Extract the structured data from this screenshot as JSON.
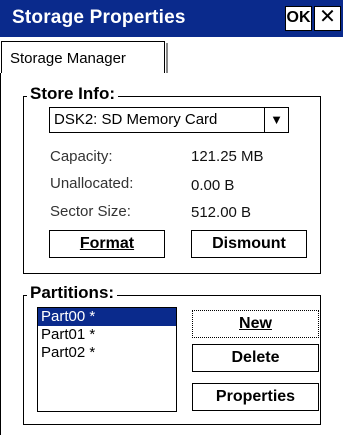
{
  "window": {
    "title": "Storage Properties",
    "ok_label": "OK",
    "close_glyph": "✕"
  },
  "tabs": [
    {
      "label": "Storage Manager"
    }
  ],
  "store_info": {
    "legend": "Store Info:",
    "selected_store": "DSK2: SD Memory Card",
    "fields": [
      {
        "label": "Capacity:",
        "value": "121.25 MB"
      },
      {
        "label": "Unallocated:",
        "value": "0.00 B"
      },
      {
        "label": "Sector Size:",
        "value": "512.00 B"
      }
    ],
    "format_label": "Format",
    "dismount_label": "Dismount"
  },
  "partitions": {
    "legend": "Partitions:",
    "items": [
      {
        "label": "Part00 *",
        "selected": true
      },
      {
        "label": "Part01 *",
        "selected": false
      },
      {
        "label": "Part02 *",
        "selected": false
      }
    ],
    "new_label": "New",
    "delete_label": "Delete",
    "properties_label": "Properties"
  },
  "colors": {
    "titlebar": "#0a2a8c",
    "selection": "#0a2a8c"
  }
}
